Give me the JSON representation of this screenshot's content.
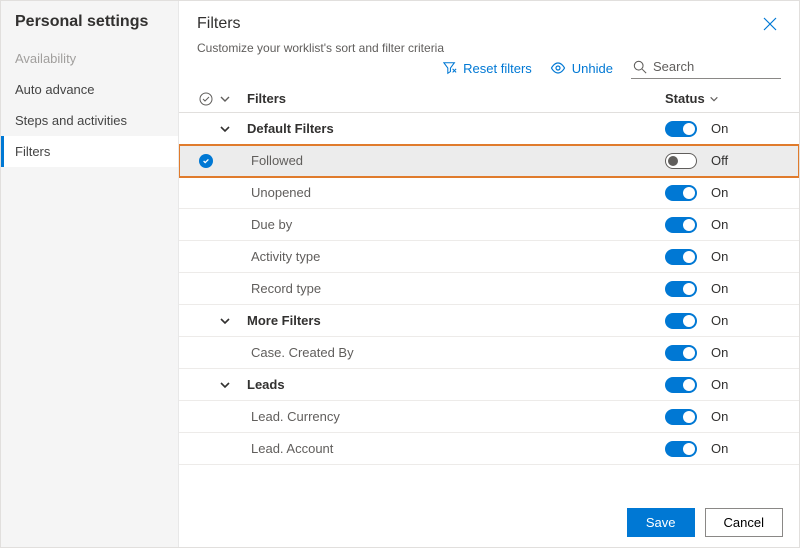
{
  "sidebar": {
    "title": "Personal settings",
    "items": [
      {
        "label": "Availability",
        "muted": true
      },
      {
        "label": "Auto advance"
      },
      {
        "label": "Steps and activities"
      },
      {
        "label": "Filters",
        "active": true
      }
    ]
  },
  "header": {
    "title": "Filters",
    "subtitle": "Customize your worklist's sort and filter criteria"
  },
  "toolbar": {
    "reset": "Reset filters",
    "unhide": "Unhide",
    "search_placeholder": "Search"
  },
  "columns": {
    "name": "Filters",
    "status": "Status"
  },
  "status_labels": {
    "on": "On",
    "off": "Off"
  },
  "rows": [
    {
      "type": "group",
      "name": "Default Filters",
      "status": "on"
    },
    {
      "type": "child",
      "name": "Followed",
      "status": "off",
      "selected": true
    },
    {
      "type": "child",
      "name": "Unopened",
      "status": "on"
    },
    {
      "type": "child",
      "name": "Due by",
      "status": "on"
    },
    {
      "type": "child",
      "name": "Activity type",
      "status": "on"
    },
    {
      "type": "child",
      "name": "Record type",
      "status": "on"
    },
    {
      "type": "group",
      "name": "More Filters",
      "status": "on"
    },
    {
      "type": "child",
      "name": "Case. Created By",
      "status": "on"
    },
    {
      "type": "group",
      "name": "Leads",
      "status": "on"
    },
    {
      "type": "child",
      "name": "Lead. Currency",
      "status": "on"
    },
    {
      "type": "child",
      "name": "Lead. Account",
      "status": "on"
    }
  ],
  "footer": {
    "save": "Save",
    "cancel": "Cancel"
  }
}
